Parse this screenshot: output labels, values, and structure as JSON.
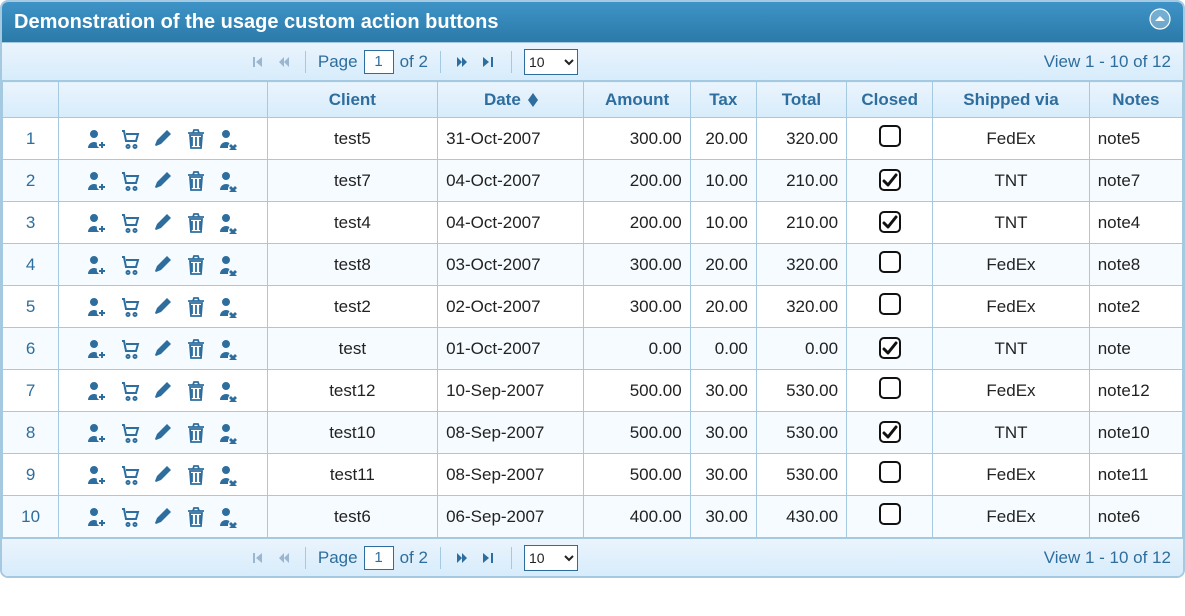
{
  "title": "Demonstration of the usage custom action buttons",
  "pager": {
    "page_label": "Page",
    "page_value": "1",
    "of_label": "of 2",
    "page_size_selected": "10",
    "view_info": "View 1 - 10 of 12"
  },
  "columns": {
    "rownum": "",
    "actions": "",
    "client": "Client",
    "date": "Date",
    "amount": "Amount",
    "tax": "Tax",
    "total": "Total",
    "closed": "Closed",
    "shipped": "Shipped via",
    "notes": "Notes"
  },
  "rows": [
    {
      "n": "1",
      "client": "test5",
      "date": "31-Oct-2007",
      "amount": "300.00",
      "tax": "20.00",
      "total": "320.00",
      "closed": false,
      "shipped": "FedEx",
      "notes": "note5"
    },
    {
      "n": "2",
      "client": "test7",
      "date": "04-Oct-2007",
      "amount": "200.00",
      "tax": "10.00",
      "total": "210.00",
      "closed": true,
      "shipped": "TNT",
      "notes": "note7"
    },
    {
      "n": "3",
      "client": "test4",
      "date": "04-Oct-2007",
      "amount": "200.00",
      "tax": "10.00",
      "total": "210.00",
      "closed": true,
      "shipped": "TNT",
      "notes": "note4"
    },
    {
      "n": "4",
      "client": "test8",
      "date": "03-Oct-2007",
      "amount": "300.00",
      "tax": "20.00",
      "total": "320.00",
      "closed": false,
      "shipped": "FedEx",
      "notes": "note8"
    },
    {
      "n": "5",
      "client": "test2",
      "date": "02-Oct-2007",
      "amount": "300.00",
      "tax": "20.00",
      "total": "320.00",
      "closed": false,
      "shipped": "FedEx",
      "notes": "note2"
    },
    {
      "n": "6",
      "client": "test",
      "date": "01-Oct-2007",
      "amount": "0.00",
      "tax": "0.00",
      "total": "0.00",
      "closed": true,
      "shipped": "TNT",
      "notes": "note"
    },
    {
      "n": "7",
      "client": "test12",
      "date": "10-Sep-2007",
      "amount": "500.00",
      "tax": "30.00",
      "total": "530.00",
      "closed": false,
      "shipped": "FedEx",
      "notes": "note12"
    },
    {
      "n": "8",
      "client": "test10",
      "date": "08-Sep-2007",
      "amount": "500.00",
      "tax": "30.00",
      "total": "530.00",
      "closed": true,
      "shipped": "TNT",
      "notes": "note10"
    },
    {
      "n": "9",
      "client": "test11",
      "date": "08-Sep-2007",
      "amount": "500.00",
      "tax": "30.00",
      "total": "530.00",
      "closed": false,
      "shipped": "FedEx",
      "notes": "note11"
    },
    {
      "n": "10",
      "client": "test6",
      "date": "06-Sep-2007",
      "amount": "400.00",
      "tax": "30.00",
      "total": "430.00",
      "closed": false,
      "shipped": "FedEx",
      "notes": "note6"
    }
  ]
}
